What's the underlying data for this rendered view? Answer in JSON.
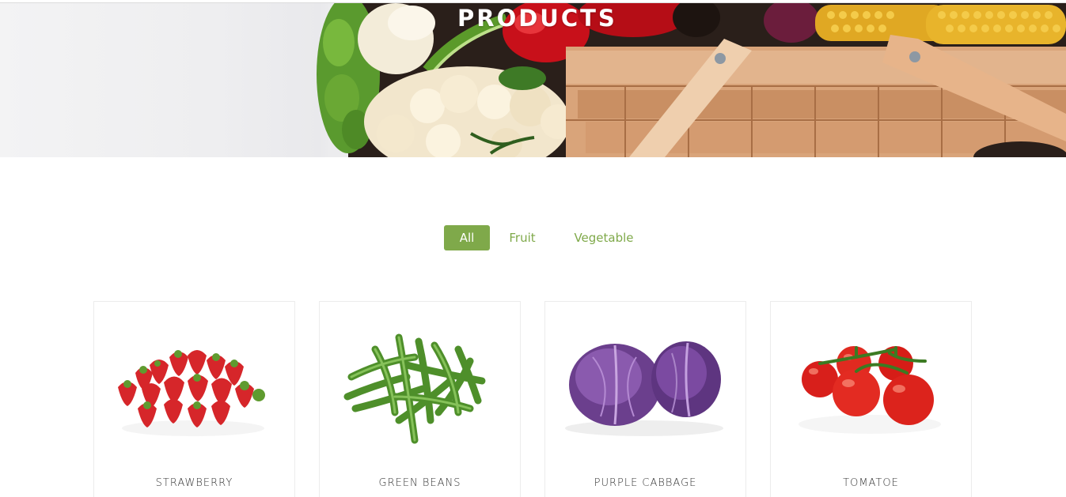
{
  "hero": {
    "title": "PRODUCTS"
  },
  "filters": {
    "items": [
      {
        "label": "All",
        "active": true
      },
      {
        "label": "Fruit",
        "active": false
      },
      {
        "label": "Vegetable",
        "active": false
      }
    ]
  },
  "products": [
    {
      "name": "STRAWBERRY",
      "image_icon": "strawberry-image"
    },
    {
      "name": "GREEN BEANS",
      "image_icon": "green-beans-image"
    },
    {
      "name": "PURPLE CABBAGE",
      "image_icon": "purple-cabbage-image"
    },
    {
      "name": "TOMATOE",
      "image_icon": "tomato-image"
    }
  ],
  "colors": {
    "accent": "#7fa94a",
    "text": "#333333",
    "card_border": "#ececec"
  }
}
